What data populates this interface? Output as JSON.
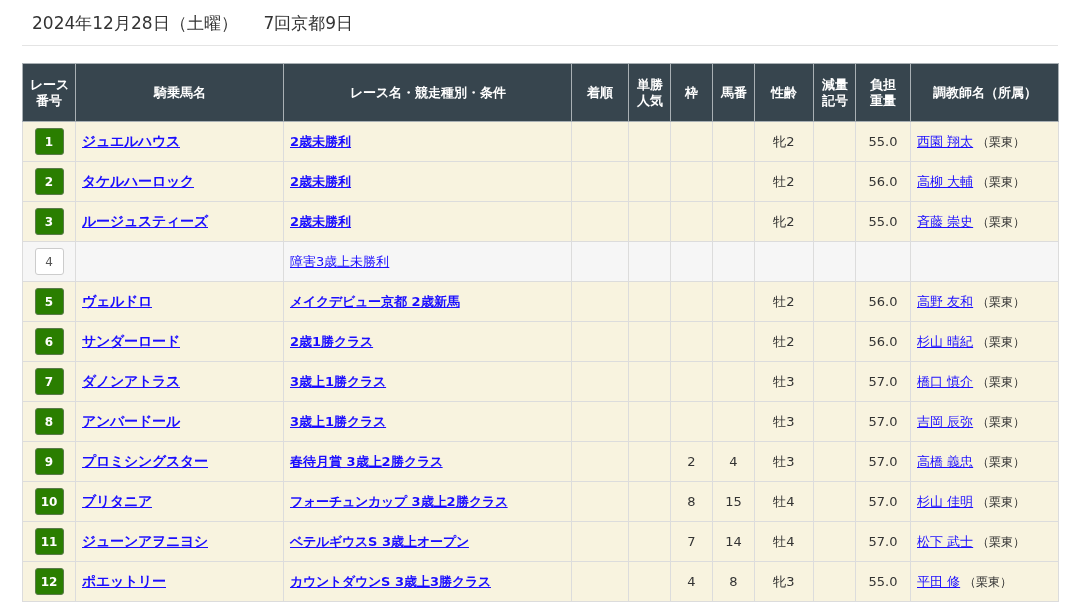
{
  "heading": {
    "date": "2024年12月28日（土曜）",
    "meeting": "7回京都9日"
  },
  "table": {
    "columns": [
      "レース番号",
      "騎乗馬名",
      "レース名・競走種別・条件",
      "着順",
      "単勝人気",
      "枠",
      "馬番",
      "性齢",
      "減量記号",
      "負担重量",
      "調教師名（所属）"
    ],
    "rows": [
      {
        "kind": "ride",
        "race_no": "1",
        "horse": "ジュエルハウス",
        "race": "2歳未勝利",
        "finish": "",
        "popularity": "",
        "frame": "",
        "number": "",
        "sex_age": "牝2",
        "mark": "",
        "weight": "55.0",
        "trainer": "西園 翔太",
        "affiliation": "（栗東）"
      },
      {
        "kind": "ride",
        "race_no": "2",
        "horse": "タケルハーロック",
        "race": "2歳未勝利",
        "finish": "",
        "popularity": "",
        "frame": "",
        "number": "",
        "sex_age": "牡2",
        "mark": "",
        "weight": "56.0",
        "trainer": "高柳 大輔",
        "affiliation": "（栗東）"
      },
      {
        "kind": "ride",
        "race_no": "3",
        "horse": "ルージュスティーズ",
        "race": "2歳未勝利",
        "finish": "",
        "popularity": "",
        "frame": "",
        "number": "",
        "sex_age": "牝2",
        "mark": "",
        "weight": "55.0",
        "trainer": "斉藤 崇史",
        "affiliation": "（栗東）"
      },
      {
        "kind": "none",
        "race_no": "4",
        "horse": "",
        "race": "障害3歳上未勝利",
        "finish": "",
        "popularity": "",
        "frame": "",
        "number": "",
        "sex_age": "",
        "mark": "",
        "weight": "",
        "trainer": "",
        "affiliation": ""
      },
      {
        "kind": "ride",
        "race_no": "5",
        "horse": "ヴェルドロ",
        "race": "メイクデビュー京都 2歳新馬",
        "finish": "",
        "popularity": "",
        "frame": "",
        "number": "",
        "sex_age": "牡2",
        "mark": "",
        "weight": "56.0",
        "trainer": "高野 友和",
        "affiliation": "（栗東）"
      },
      {
        "kind": "ride",
        "race_no": "6",
        "horse": "サンダーロード",
        "race": "2歳1勝クラス",
        "finish": "",
        "popularity": "",
        "frame": "",
        "number": "",
        "sex_age": "牡2",
        "mark": "",
        "weight": "56.0",
        "trainer": "杉山 晴紀",
        "affiliation": "（栗東）"
      },
      {
        "kind": "ride",
        "race_no": "7",
        "horse": "ダノンアトラス",
        "race": "3歳上1勝クラス",
        "finish": "",
        "popularity": "",
        "frame": "",
        "number": "",
        "sex_age": "牡3",
        "mark": "",
        "weight": "57.0",
        "trainer": "橋口 慎介",
        "affiliation": "（栗東）"
      },
      {
        "kind": "ride",
        "race_no": "8",
        "horse": "アンバードール",
        "race": "3歳上1勝クラス",
        "finish": "",
        "popularity": "",
        "frame": "",
        "number": "",
        "sex_age": "牡3",
        "mark": "",
        "weight": "57.0",
        "trainer": "吉岡 辰弥",
        "affiliation": "（栗東）"
      },
      {
        "kind": "ride",
        "race_no": "9",
        "horse": "プロミシングスター",
        "race": "春待月賞 3歳上2勝クラス",
        "finish": "",
        "popularity": "",
        "frame": "2",
        "number": "4",
        "sex_age": "牡3",
        "mark": "",
        "weight": "57.0",
        "trainer": "高橋 義忠",
        "affiliation": "（栗東）"
      },
      {
        "kind": "ride",
        "race_no": "10",
        "horse": "ブリタニア",
        "race": "フォーチュンカップ 3歳上2勝クラス",
        "finish": "",
        "popularity": "",
        "frame": "8",
        "number": "15",
        "sex_age": "牡4",
        "mark": "",
        "weight": "57.0",
        "trainer": "杉山 佳明",
        "affiliation": "（栗東）"
      },
      {
        "kind": "ride",
        "race_no": "11",
        "horse": "ジューンアヲニヨシ",
        "race": "ベテルギウスS 3歳上オープン",
        "finish": "",
        "popularity": "",
        "frame": "7",
        "number": "14",
        "sex_age": "牡4",
        "mark": "",
        "weight": "57.0",
        "trainer": "松下 武士",
        "affiliation": "（栗東）"
      },
      {
        "kind": "ride",
        "race_no": "12",
        "horse": "ポエットリー",
        "race": "カウントダウンS 3歳上3勝クラス",
        "finish": "",
        "popularity": "",
        "frame": "4",
        "number": "8",
        "sex_age": "牝3",
        "mark": "",
        "weight": "55.0",
        "trainer": "平田 修",
        "affiliation": "（栗東）"
      }
    ]
  }
}
